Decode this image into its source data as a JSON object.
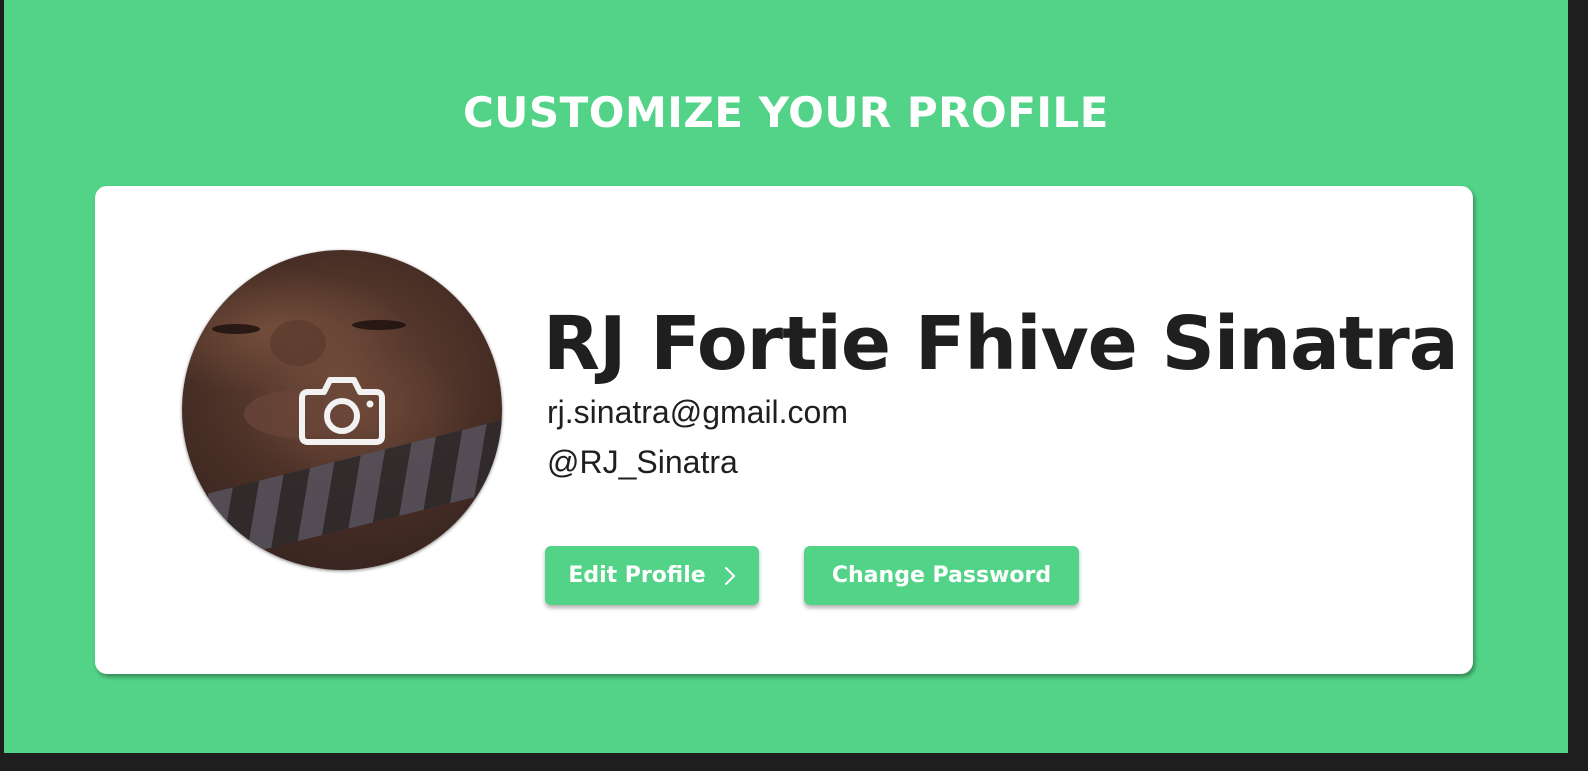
{
  "page": {
    "title": "CUSTOMIZE YOUR PROFILE",
    "background_color": "#53d388",
    "accent_color": "#53d388"
  },
  "profile": {
    "name": "RJ Fortie Fhive Sinatra",
    "email": "rj.sinatra@gmail.com",
    "handle": "@RJ_Sinatra",
    "avatar_overlay_icon": "camera-icon"
  },
  "actions": {
    "edit_profile_label": "Edit Profile",
    "edit_profile_icon": "chevron-right-icon",
    "change_password_label": "Change Password"
  }
}
